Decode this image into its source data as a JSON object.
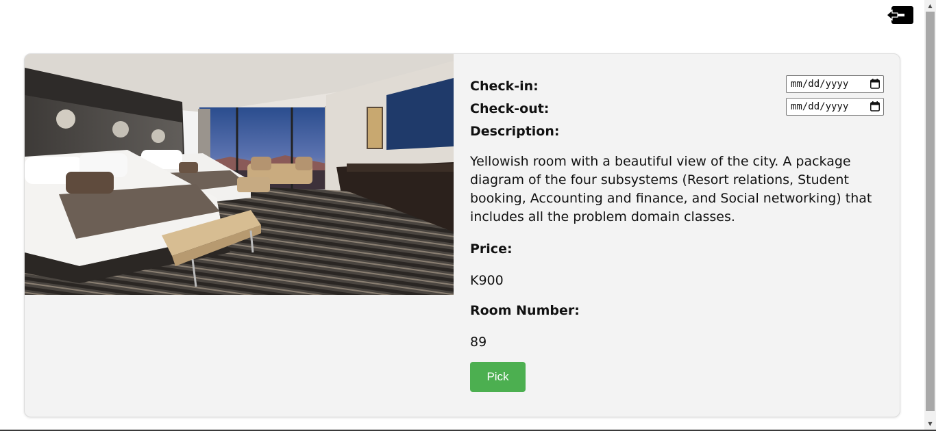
{
  "booking": {
    "checkin_label": "Check-in:",
    "checkin_value": "mm/dd/yyyy",
    "checkout_label": "Check-out:",
    "checkout_value": "mm/dd/yyyy",
    "description_label": "Description:",
    "description_text": "Yellowish room with a beautiful view of the city. A package diagram of the four subsystems (Resort relations, Student booking, Accounting and finance, and Social networking) that includes all the problem domain classes.",
    "price_label": "Price:",
    "price_value": "K900",
    "room_number_label": "Room Number:",
    "room_number_value": "89",
    "pick_label": "Pick"
  },
  "icons": {
    "logout": "logout-arrow-icon",
    "calendar": "calendar-icon"
  },
  "colors": {
    "card_bg": "#f3f3f3",
    "pick_button": "#4caf50"
  }
}
